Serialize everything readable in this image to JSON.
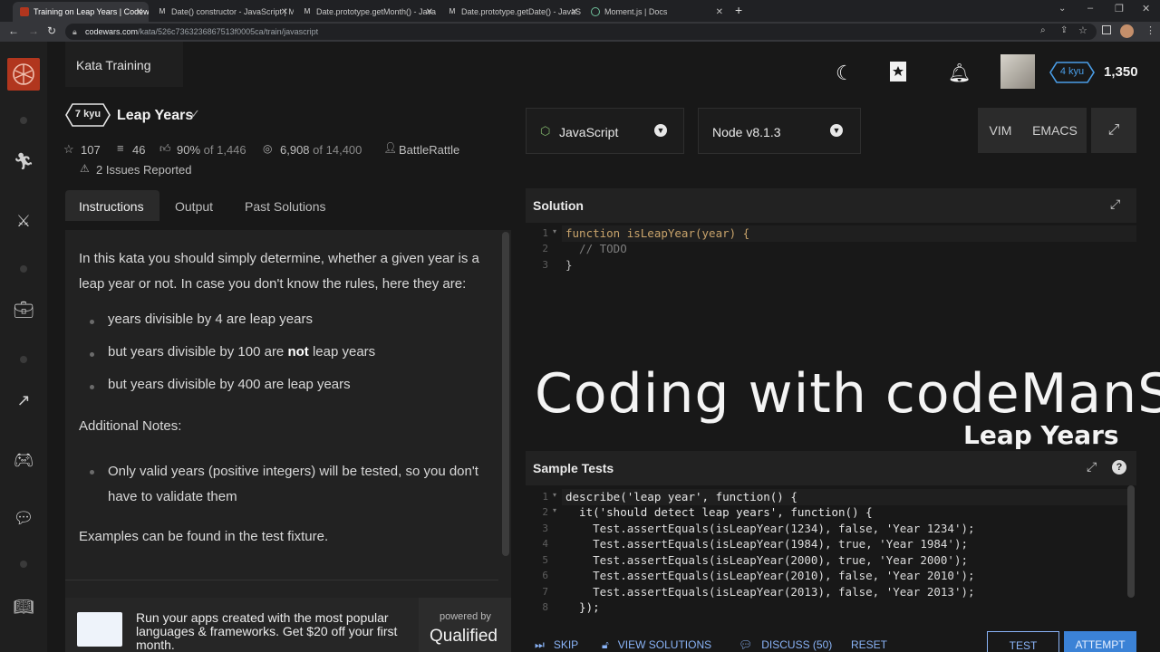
{
  "browser": {
    "tabs": [
      {
        "label": "Training on Leap Years | Codewa"
      },
      {
        "label": "Date() constructor - JavaScript | M"
      },
      {
        "label": "Date.prototype.getMonth() - Java"
      },
      {
        "label": "Date.prototype.getDate() - JavaS"
      },
      {
        "label": "Moment.js | Docs"
      }
    ],
    "url_host": "codewars.com",
    "url_path": "/kata/526c7363236867513f0005ca/train/javascript",
    "new_tab": "+"
  },
  "header": {
    "title": "Kata Training",
    "rank": "4 kyu",
    "honor": "1,350"
  },
  "kata": {
    "kyu": "7 kyu",
    "name": "Leap Years",
    "stars": "107",
    "collections": "46",
    "satisfaction": "90%",
    "satisfaction_of": "of 1,446",
    "completed": "6,908",
    "completed_of": "of 14,400",
    "author": "BattleRattle",
    "issues": "2 Issues Reported"
  },
  "tabs": {
    "instructions": "Instructions",
    "output": "Output",
    "past": "Past Solutions"
  },
  "instructions": {
    "p1": "In this kata you should simply determine, whether a given year is a leap year or not. In case you don't know the rules, here they are:",
    "b1": "years divisible by 4 are leap years",
    "b2_pre": "but years divisible by 100 are ",
    "b2_bold": "not",
    "b2_post": " leap years",
    "b3": "but years divisible by 400 are leap years",
    "notes_title": "Additional Notes:",
    "b4": "Only valid years (positive integers) will be tested, so you don't have to validate them",
    "p2": "Examples can be found in the test fixture."
  },
  "ad": {
    "text": "Run your apps created with the most popular languages & frameworks. Get $20 off your first month.",
    "powered": "powered by",
    "brand": "Qualified"
  },
  "editor": {
    "language": "JavaScript",
    "runtime": "Node v8.1.3",
    "vim": "VIM",
    "emacs": "EMACS",
    "solution_title": "Solution",
    "solution_lines": [
      "function isLeapYear(year) {",
      "  // TODO",
      "}"
    ],
    "tests_title": "Sample Tests",
    "test_lines": [
      "describe('leap year', function() {",
      "  it('should detect leap years', function() {",
      "    Test.assertEquals(isLeapYear(1234), false, 'Year 1234');",
      "    Test.assertEquals(isLeapYear(1984), true, 'Year 1984');",
      "    Test.assertEquals(isLeapYear(2000), true, 'Year 2000');",
      "    Test.assertEquals(isLeapYear(2010), false, 'Year 2010');",
      "    Test.assertEquals(isLeapYear(2013), false, 'Year 2013');",
      "  });"
    ]
  },
  "overlay": {
    "title": "Coding with codeManS",
    "subtitle": "Leap Years"
  },
  "footer": {
    "skip": "SKIP",
    "view": "VIEW SOLUTIONS",
    "discuss": "DISCUSS (50)",
    "reset": "RESET",
    "test": "TEST",
    "attempt": "ATTEMPT"
  }
}
